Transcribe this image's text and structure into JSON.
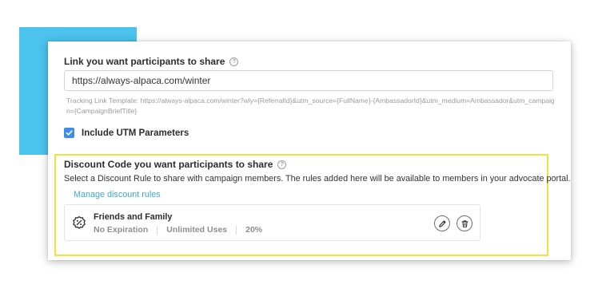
{
  "link_section": {
    "label": "Link you want participants to share",
    "url_value": "https://always-alpaca.com/winter",
    "tracking_template": "Tracking Link Template:  https://always-alpaca.com/winter?wly={ReferralId}&utm_source={FullName}-{AmbassadorId}&utm_medium=Ambassador&utm_campaign={CampaignBriefTitle}",
    "utm_checkbox_label": "Include UTM Parameters",
    "utm_checked": true
  },
  "discount_section": {
    "label": "Discount Code you want participants to share",
    "description": "Select a Discount Rule to share with campaign members. The rules added here will be available to members in your advocate portal.",
    "manage_link": "Manage discount rules",
    "rule": {
      "name": "Friends and Family",
      "expiration": "No Expiration",
      "uses": "Unlimited Uses",
      "discount": "20%"
    }
  },
  "colors": {
    "accent_block": "#4bc3ec",
    "highlight_border": "#f2e13a",
    "link": "#3aa9d6",
    "checkbox": "#3d8ee6"
  },
  "icons": [
    "help-icon",
    "checkmark-icon",
    "percent-badge-icon",
    "edit-icon",
    "trash-icon"
  ]
}
